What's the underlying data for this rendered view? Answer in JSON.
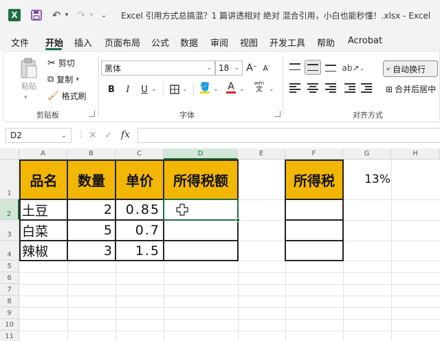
{
  "app": {
    "logo": "X",
    "title": "Excel 引用方式总搞混？1 篇讲透相对  绝对  混合引用，小白也能秒懂！.xlsx  -  Excel"
  },
  "quick_access": {
    "icons": [
      "excel-logo",
      "save-icon",
      "undo-icon",
      "redo-icon",
      "more-icon"
    ]
  },
  "tabs": [
    "文件",
    "开始",
    "插入",
    "页面布局",
    "公式",
    "数据",
    "审阅",
    "视图",
    "开发工具",
    "帮助",
    "Acrobat"
  ],
  "active_tab": "开始",
  "ribbon": {
    "clipboard": {
      "paste": "粘贴",
      "cut": "剪切",
      "copy": "复制",
      "format_painter": "格式刷",
      "label": "剪贴板"
    },
    "font": {
      "name": "黑体",
      "size": "18",
      "grow": "A",
      "shrink": "A",
      "bold": "B",
      "italic": "I",
      "underline": "U",
      "font_color": "A",
      "phonetic": "wén",
      "label": "字体"
    },
    "alignment": {
      "wrap_text": "自动换行",
      "merge_center": "合并后居中",
      "label": "对齐方式"
    }
  },
  "formula_bar": {
    "name_box": "D2",
    "fx": "fx",
    "formula": ""
  },
  "sheet": {
    "columns": [
      "A",
      "B",
      "C",
      "D",
      "E",
      "F",
      "G",
      "H"
    ],
    "selected_column": "D",
    "rows": [
      "1",
      "2",
      "3",
      "4",
      "5",
      "6",
      "7",
      "8",
      "9",
      "10",
      "11"
    ],
    "selected_row": "2",
    "active_cell": "D2",
    "header_row": [
      "品名",
      "数量",
      "单价",
      "所得税额"
    ],
    "data_rows": [
      {
        "name": "土豆",
        "qty": "2",
        "price": "0.85",
        "tax": ""
      },
      {
        "name": "白菜",
        "qty": "5",
        "price": "0.7",
        "tax": ""
      },
      {
        "name": "辣椒",
        "qty": "3",
        "price": "1.5",
        "tax": ""
      }
    ],
    "tax_rate_label": "所得税",
    "tax_rate_value": "13%"
  },
  "colors": {
    "header_fill": "#f2b705",
    "excel_green": "#1d6f42",
    "font_highlight": "#f5d100",
    "font_color_bar": "#e02020"
  }
}
